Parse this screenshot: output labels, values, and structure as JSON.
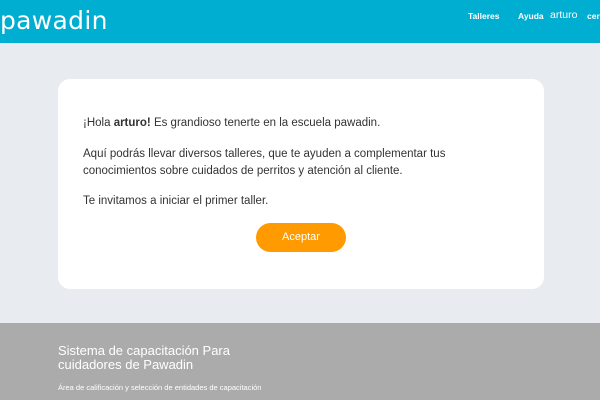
{
  "header": {
    "logo_text": "pawadin",
    "nav": {
      "workshops": "Talleres",
      "help": "Ayuda",
      "user": "arturo",
      "cut_item": "cer"
    }
  },
  "welcome_card": {
    "greeting_prefix": "¡Hola ",
    "user_name": "arturo!",
    "greeting_suffix": " Es grandioso tenerte en la escuela pawadin.",
    "paragraph_line1": "Aquí podrás llevar diversos talleres, que te ayuden a complementar tus",
    "paragraph_line2": "conocimientos sobre cuidados de perritos y atención al cliente.",
    "invite": "Te invitamos a iniciar el primer taller.",
    "accept_button": "Aceptar"
  },
  "footer": {
    "title": "Sistema de capacitación Para cuidadores de Pawadin",
    "subtitle": "Área de calificación y selección de entidades de capacitación"
  },
  "colors": {
    "header_bg": "#00aed1",
    "page_bg": "#e8ebef",
    "accent_button": "#ff9a00",
    "footer_bg": "#ababab"
  }
}
